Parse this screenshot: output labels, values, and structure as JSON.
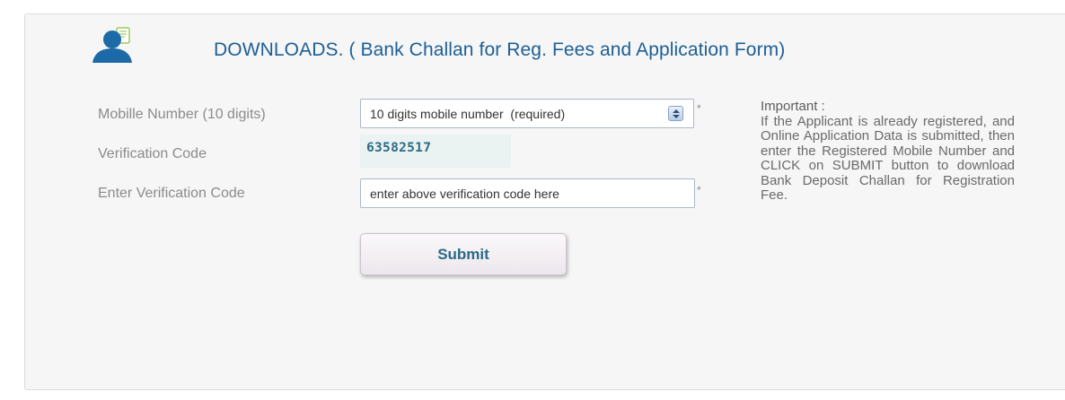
{
  "header": {
    "title": "DOWNLOADS. ( Bank Challan for Reg. Fees and Application Form)",
    "icon": "user-document-icon"
  },
  "form": {
    "mobile_label": "Mobille Number (10 digits)",
    "mobile_placeholder": "10 digits mobile number  (required)",
    "verification_label": "Verification Code",
    "verification_code": "63582517",
    "enter_code_label": "Enter Verification Code",
    "enter_code_placeholder": "enter above verification code here",
    "required_marker": "*",
    "submit_label": "Submit"
  },
  "info": {
    "title": "Important :",
    "text": "If the Applicant is already registered, and Online Application Data is submitted, then enter the Registered Mobile Number and CLICK on SUBMIT button to download Bank Deposit Challan for Registration Fee."
  },
  "colors": {
    "title": "#1d5f94",
    "accent": "#2a6a86",
    "panel_bg": "#f6f6f6",
    "code_bg": "#ebf2f2"
  }
}
